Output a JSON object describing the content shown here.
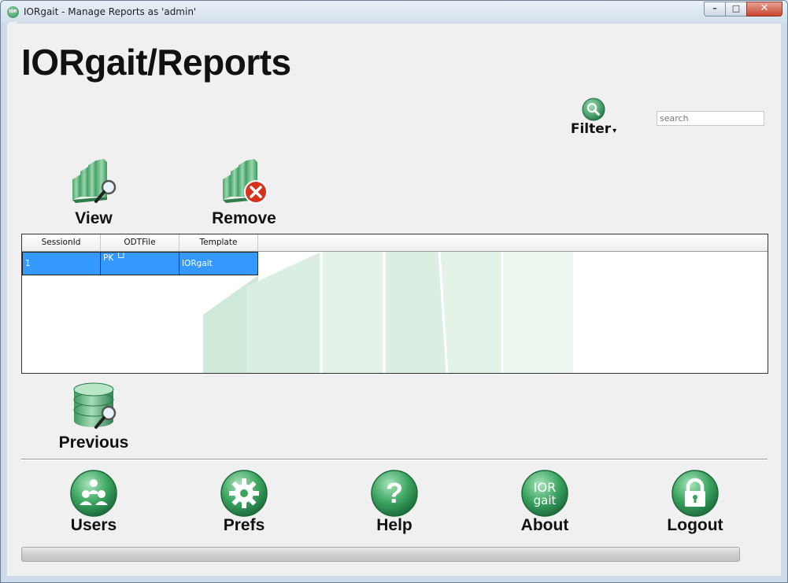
{
  "window": {
    "title": "IORgait - Manage Reports as 'admin'",
    "app_icon_text": "IOR gait",
    "controls": {
      "minimize": "–",
      "maximize": "□",
      "close": "✕"
    }
  },
  "header": {
    "title": "IORgait/Reports"
  },
  "filter": {
    "label": "Filter",
    "caret": "▾",
    "icon": "search-icon"
  },
  "search": {
    "placeholder": "search"
  },
  "toolbar": {
    "view_label": "View",
    "remove_label": "Remove"
  },
  "table": {
    "columns": [
      "SessionId",
      "ODTFile",
      "Template"
    ],
    "rows": [
      {
        "session_id": "1",
        "odt_file": "PK └┘",
        "template": "IORgait"
      }
    ]
  },
  "previous": {
    "label": "Previous"
  },
  "nav": {
    "users": "Users",
    "prefs": "Prefs",
    "help": "Help",
    "about": "About",
    "about_icon_text_top": "IOR",
    "about_icon_text_bottom": "gait",
    "logout": "Logout"
  },
  "progress": {
    "value": 0
  },
  "colors": {
    "accent_green": "#2f9a55",
    "selection_blue": "#3399ff",
    "close_red": "#c7452f"
  }
}
